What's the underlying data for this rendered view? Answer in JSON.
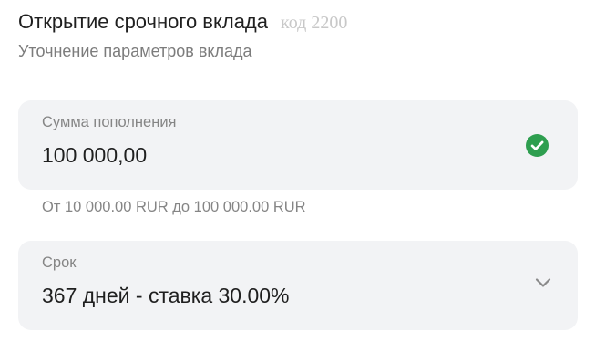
{
  "header": {
    "title": "Открытие срочного вклада",
    "code": "код 2200",
    "subtitle": "Уточнение параметров вклада"
  },
  "amount_field": {
    "label": "Сумма пополнения",
    "value": "100 000,00",
    "valid_icon": "check-circle-icon",
    "valid_color": "#2e9e4f"
  },
  "amount_hint": "От 10 000.00 RUR до 100 000.00 RUR",
  "term_field": {
    "label": "Срок",
    "value": "367 дней - ставка 30.00%",
    "dropdown_icon": "chevron-down-icon"
  }
}
